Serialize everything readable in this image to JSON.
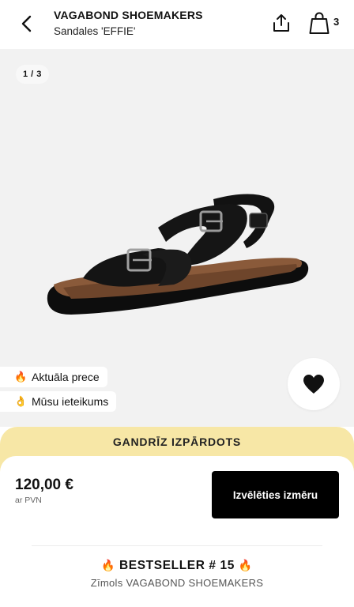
{
  "header": {
    "brand": "VAGABOND SHOEMAKERS",
    "product_name": "Sandales 'EFFIE'",
    "bag_count": "3",
    "icons": {
      "back": "chevron-left-icon",
      "share": "share-icon",
      "bag": "shopping-bag-icon"
    }
  },
  "gallery": {
    "counter": "1 / 3",
    "current_image": 1,
    "total_images": 3
  },
  "tags": [
    {
      "emoji": "🔥",
      "label": "Aktuāla prece"
    },
    {
      "emoji": "👌",
      "label": "Mūsu ieteikums"
    }
  ],
  "wishlist": {
    "icon": "heart-icon",
    "active": true
  },
  "banner": {
    "text": "GANDRĪZ IZPĀRDOTS",
    "color": "#f7e7a6"
  },
  "price": {
    "value": "120,00 €",
    "vat_note": "ar PVN"
  },
  "actions": {
    "select_size_label": "Izvēlēties izmēru"
  },
  "bestseller": {
    "emoji": "🔥",
    "label": "BESTSELLER # 15",
    "subtitle": "Zīmols VAGABOND SHOEMAKERS"
  },
  "colors": {
    "accent": "#000000",
    "background": "#ffffff",
    "gallery_bg": "#f2f2f2"
  }
}
